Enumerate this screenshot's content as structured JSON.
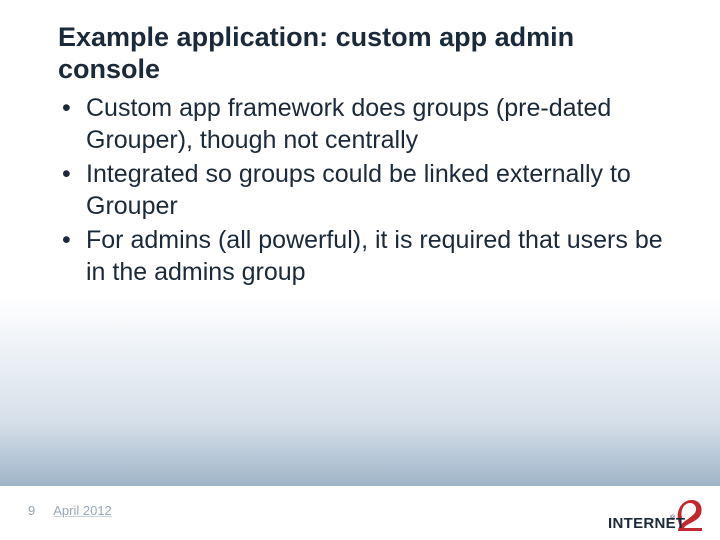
{
  "title": "Example application: custom app admin console",
  "bullets": [
    "Custom app framework does groups (pre-dated Grouper), though not centrally",
    "Integrated so groups could be linked externally to Grouper",
    "For admins (all powerful), it is required that users be in the admins group"
  ],
  "footer": {
    "page": "9",
    "date": "April 2012"
  },
  "logo": {
    "text": "INTERNET",
    "reg": "®"
  }
}
